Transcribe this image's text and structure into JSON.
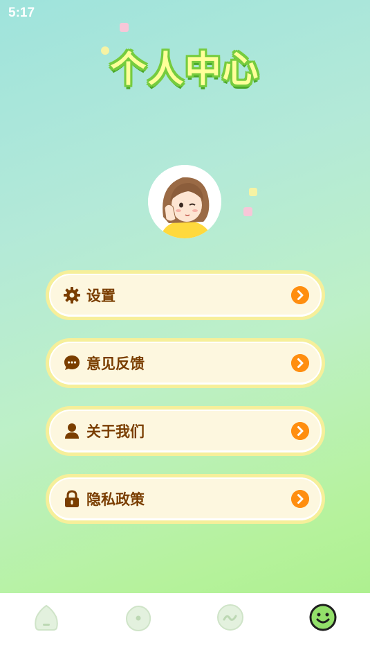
{
  "status_bar": {
    "time": "5:17"
  },
  "page": {
    "title": "个人中心"
  },
  "menu": [
    {
      "label": "设置",
      "icon": "gear-icon"
    },
    {
      "label": "意见反馈",
      "icon": "chat-bubble-icon"
    },
    {
      "label": "关于我们",
      "icon": "person-icon"
    },
    {
      "label": "隐私政策",
      "icon": "lock-icon"
    }
  ],
  "tabbar": {
    "tabs": [
      {
        "icon": "home-icon",
        "active": false
      },
      {
        "icon": "circle-dot-icon",
        "active": false
      },
      {
        "icon": "wave-icon",
        "active": false
      },
      {
        "icon": "smiley-face-icon",
        "active": true
      }
    ]
  },
  "colors": {
    "label": "#7a3e00",
    "arrow": "#ff8e0f",
    "card_border": "#f6ef9a",
    "tab_inactive": "#d7ecd0",
    "tab_active": "#93e06a"
  }
}
